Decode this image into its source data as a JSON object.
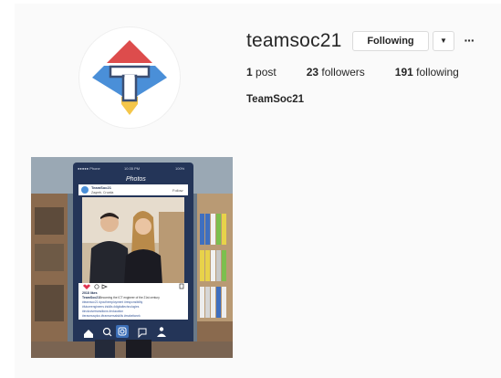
{
  "profile": {
    "username": "teamsoc21",
    "following_button": "Following",
    "dropdown_icon": "caret-down-icon",
    "more_icon": "ellipsis-icon",
    "dropdown_glyph": "▼",
    "more_glyph": "···",
    "stats": {
      "posts_count": "1",
      "posts_label": "post",
      "followers_count": "23",
      "followers_label": "followers",
      "following_count": "191",
      "following_label": "following"
    },
    "full_name": "TeamSoc21"
  },
  "post_image": {
    "phone_status_carrier": "●●●●● Phone",
    "phone_status_time": "10:35 PM",
    "phone_status_battery": "100%",
    "app_header": "Photos",
    "post_user": "TeamSoc21",
    "post_location": "Zagreb, Croatia",
    "post_follow": "Follow",
    "likes": "2018 likes",
    "caption_user": "TeamSoc21",
    "caption_line1": "Becoming the ICT engineer of the 21st century",
    "caption_line2": "#teamsoc21 #youthemployment #responsibility",
    "caption_line3": "#futureengineers #skills #digitaltechnologies",
    "caption_line4": "#inclusivetransitions #education",
    "caption_line5": "#erasmusplus #transversalskills #makeitwork"
  },
  "colors": {
    "logo_red": "#dd4c4c",
    "logo_blue": "#4a8fd8",
    "logo_yellow": "#f4c64a",
    "logo_navy": "#3c4f73",
    "frame_navy": "#243558"
  }
}
